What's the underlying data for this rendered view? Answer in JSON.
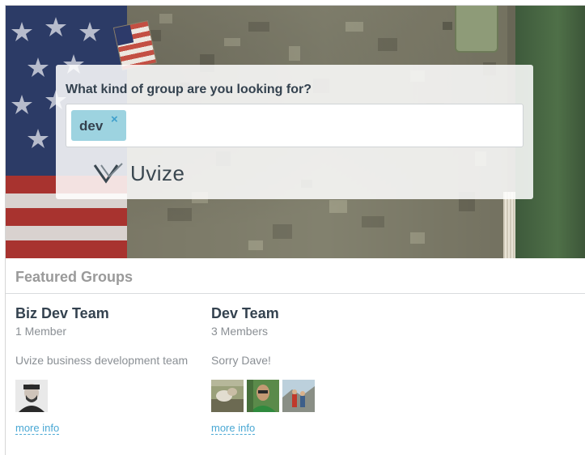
{
  "search": {
    "question": "What kind of group are you looking for?",
    "tags": [
      {
        "label": "dev",
        "remove_glyph": "×"
      }
    ]
  },
  "brand": {
    "name": "Uvize",
    "logo_icon": "uvize-chevron-logo"
  },
  "featured": {
    "title": "Featured Groups",
    "groups": [
      {
        "name": "Biz Dev Team",
        "members": "1 Member",
        "description": "Uvize business development team",
        "more_info": "more info"
      },
      {
        "name": "Dev Team",
        "members": "3 Members",
        "description": "Sorry Dave!",
        "more_info": "more info"
      }
    ]
  },
  "colors": {
    "tag_chip": "#9dd3e0",
    "link": "#4aa8d4",
    "heading": "#34424f",
    "muted": "#8a8f94"
  }
}
